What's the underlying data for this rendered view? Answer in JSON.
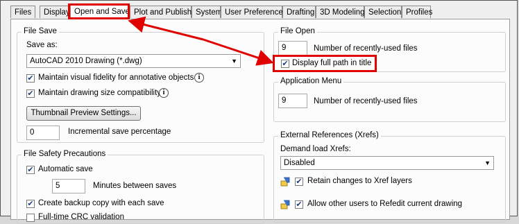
{
  "tabs": [
    "Files",
    "Display",
    "Open and Save",
    "Plot and Publish",
    "System",
    "User Preferences",
    "Drafting",
    "3D Modeling",
    "Selection",
    "Profiles"
  ],
  "active_tab": "Open and Save",
  "file_save": {
    "title": "File Save",
    "save_as_label": "Save as:",
    "save_as_value": "AutoCAD 2010 Drawing (*.dwg)",
    "maintain_fidelity": "Maintain visual fidelity for annotative objects",
    "maintain_size": "Maintain drawing size compatibility",
    "thumbnail_button": "Thumbnail Preview Settings...",
    "incremental_value": "0",
    "incremental_label": "Incremental save percentage"
  },
  "file_safety": {
    "title": "File Safety Precautions",
    "auto_save": "Automatic save",
    "minutes_value": "5",
    "minutes_label": "Minutes between saves",
    "backup_copy": "Create backup copy with each save",
    "crc": "Full-time CRC validation"
  },
  "file_open": {
    "title": "File Open",
    "recent_value": "9",
    "recent_label": "Number of recently-used files",
    "full_path": "Display full path in title"
  },
  "app_menu": {
    "title": "Application Menu",
    "recent_value": "9",
    "recent_label": "Number of recently-used files"
  },
  "xrefs": {
    "title": "External References (Xrefs)",
    "demand_label": "Demand load Xrefs:",
    "demand_value": "Disabled",
    "retain": "Retain changes to Xref layers",
    "allow_refedit": "Allow other users to Refedit current drawing"
  },
  "icons": {
    "info": "info-icon",
    "xref": "xref-icon",
    "check": "check-icon",
    "dropdown": "chevron-down-icon"
  },
  "highlight_color": "#e00000"
}
